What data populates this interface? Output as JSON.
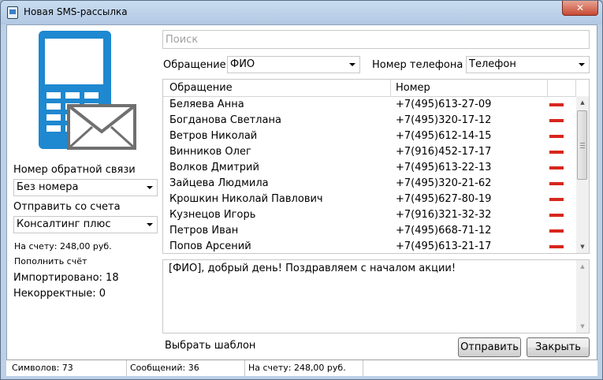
{
  "window": {
    "title": "Новая SMS-рассылка",
    "close_glyph": "✕"
  },
  "search": {
    "placeholder": "Поиск",
    "value": ""
  },
  "filters": {
    "greeting_label": "Обращение",
    "greeting_value": "ФИО",
    "phone_label": "Номер телефона",
    "phone_value": "Телефон"
  },
  "left": {
    "callback_label": "Номер обратной связи",
    "callback_value": "Без номера",
    "send_from_label": "Отправить со счета",
    "send_from_value": "Консалтинг плюс",
    "balance": "На счету: 248,00 руб.",
    "topup": "Пополнить счёт",
    "imported": "Импортировано: 18",
    "invalid": "Некорректные: 0"
  },
  "grid": {
    "columns": [
      "Обращение",
      "Номер"
    ],
    "rows": [
      {
        "name": "Беляева Анна",
        "phone": "+7(495)613-27-09"
      },
      {
        "name": "Богданова Светлана",
        "phone": "+7(495)320-17-12"
      },
      {
        "name": "Ветров Николай",
        "phone": "+7(495)612-14-15"
      },
      {
        "name": "Винников Олег",
        "phone": "+7(916)452-17-17"
      },
      {
        "name": "Волков Дмитрий",
        "phone": "+7(495)613-22-13"
      },
      {
        "name": "Зайцева Людмила",
        "phone": "+7(495)320-21-62"
      },
      {
        "name": "Крошкин Николай Павлович",
        "phone": "+7(495)627-80-19"
      },
      {
        "name": "Кузнецов Игорь",
        "phone": "+7(916)321-32-32"
      },
      {
        "name": "Петров Иван",
        "phone": "+7(495)668-71-12"
      },
      {
        "name": "Попов Арсений",
        "phone": "+7(495)613-21-17"
      }
    ]
  },
  "message": {
    "text": "[ФИО], добрый день! Поздравляем с началом акции!"
  },
  "template_link": "Выбрать шаблон",
  "buttons": {
    "send": "Отправить",
    "close": "Закрыть"
  },
  "statusbar": {
    "chars": "Символов: 73",
    "messages": "Сообщений: 36",
    "balance": "На счету: 248,00 руб."
  },
  "colors": {
    "accent": "#1e88d0",
    "delete": "#d7261d"
  },
  "icons": {
    "app": "phone-envelope-icon",
    "delete": "minus-icon"
  }
}
